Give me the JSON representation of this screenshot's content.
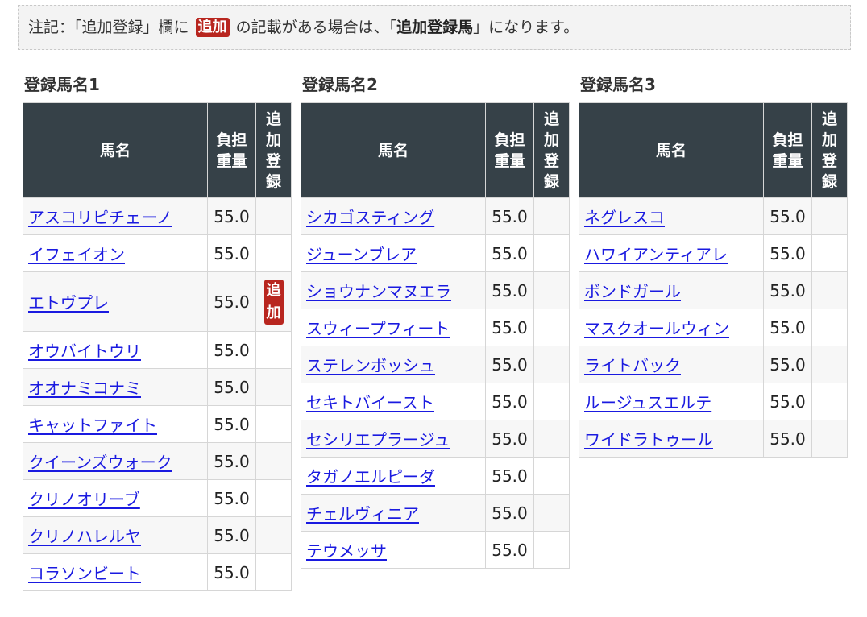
{
  "notice": {
    "prefix": "注記：「追加登録」欄に",
    "badge": "追加",
    "middle": "の記載がある場合は、「",
    "bold": "追加登録馬",
    "suffix": "」になります。"
  },
  "table_headers": {
    "name": "馬名",
    "weight": "負担重量",
    "added": "追加登録"
  },
  "groups": [
    {
      "title": "登録馬名1",
      "rows": [
        {
          "name": "アスコリピチェーノ",
          "weight": "55.0",
          "added": ""
        },
        {
          "name": "イフェイオン",
          "weight": "55.0",
          "added": ""
        },
        {
          "name": "エトヴプレ",
          "weight": "55.0",
          "added": "追加"
        },
        {
          "name": "オウバイトウリ",
          "weight": "55.0",
          "added": ""
        },
        {
          "name": "オオナミコナミ",
          "weight": "55.0",
          "added": ""
        },
        {
          "name": "キャットファイト",
          "weight": "55.0",
          "added": ""
        },
        {
          "name": "クイーンズウォーク",
          "weight": "55.0",
          "added": ""
        },
        {
          "name": "クリノオリーブ",
          "weight": "55.0",
          "added": ""
        },
        {
          "name": "クリノハレルヤ",
          "weight": "55.0",
          "added": ""
        },
        {
          "name": "コラソンビート",
          "weight": "55.0",
          "added": ""
        }
      ]
    },
    {
      "title": "登録馬名2",
      "rows": [
        {
          "name": "シカゴスティング",
          "weight": "55.0",
          "added": ""
        },
        {
          "name": "ジューンブレア",
          "weight": "55.0",
          "added": ""
        },
        {
          "name": "ショウナンマヌエラ",
          "weight": "55.0",
          "added": ""
        },
        {
          "name": "スウィープフィート",
          "weight": "55.0",
          "added": ""
        },
        {
          "name": "ステレンボッシュ",
          "weight": "55.0",
          "added": ""
        },
        {
          "name": "セキトバイースト",
          "weight": "55.0",
          "added": ""
        },
        {
          "name": "セシリエプラージュ",
          "weight": "55.0",
          "added": ""
        },
        {
          "name": "タガノエルピーダ",
          "weight": "55.0",
          "added": ""
        },
        {
          "name": "チェルヴィニア",
          "weight": "55.0",
          "added": ""
        },
        {
          "name": "テウメッサ",
          "weight": "55.0",
          "added": ""
        }
      ]
    },
    {
      "title": "登録馬名3",
      "rows": [
        {
          "name": "ネグレスコ",
          "weight": "55.0",
          "added": ""
        },
        {
          "name": "ハワイアンティアレ",
          "weight": "55.0",
          "added": ""
        },
        {
          "name": "ボンドガール",
          "weight": "55.0",
          "added": ""
        },
        {
          "name": "マスクオールウィン",
          "weight": "55.0",
          "added": ""
        },
        {
          "name": "ライトバック",
          "weight": "55.0",
          "added": ""
        },
        {
          "name": "ルージュスエルテ",
          "weight": "55.0",
          "added": ""
        },
        {
          "name": "ワイドラトゥール",
          "weight": "55.0",
          "added": ""
        }
      ]
    }
  ],
  "colors": {
    "header_bg": "#364148",
    "badge_bg": "#b8261f",
    "link": "#1a1ae0"
  }
}
